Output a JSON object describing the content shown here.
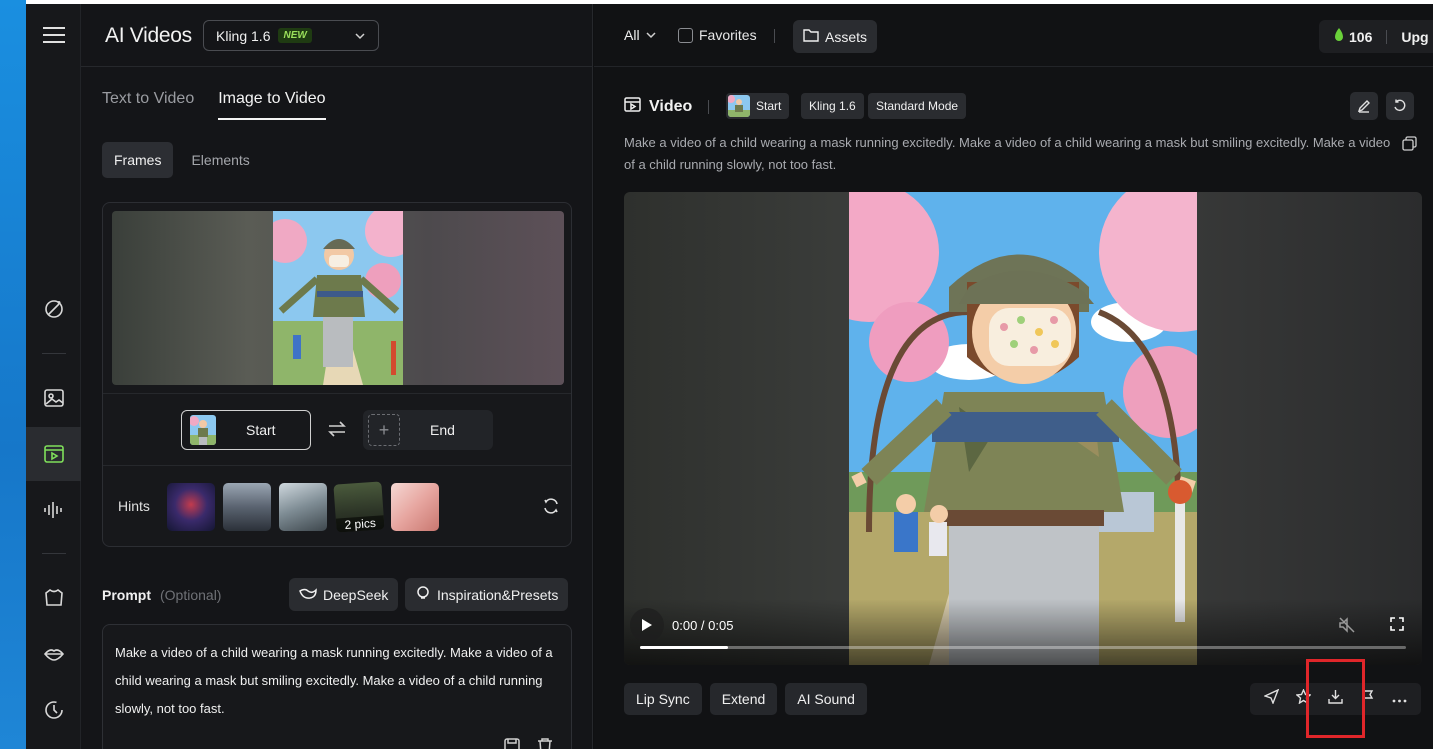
{
  "app": {
    "title": "AI Videos",
    "model": "Kling 1.6",
    "model_badge": "NEW"
  },
  "rail": {
    "items": [
      {
        "icon": "magic-wand-icon"
      },
      {
        "icon": "image-icon"
      },
      {
        "icon": "video-icon",
        "active": true
      },
      {
        "icon": "audio-wave-icon"
      },
      {
        "icon": "shirt-icon"
      },
      {
        "icon": "lips-icon"
      },
      {
        "icon": "history-icon"
      }
    ]
  },
  "creation": {
    "tabs": [
      "Text to Video",
      "Image to Video"
    ],
    "active_tab": "Image to Video",
    "subtabs": [
      "Frames",
      "Elements"
    ],
    "active_subtab": "Frames",
    "start_label": "Start",
    "end_label": "End",
    "hints_label": "Hints",
    "hint_pics_label": "2 pics",
    "prompt_label": "Prompt",
    "prompt_optional": "(Optional)",
    "deepseek_label": "DeepSeek",
    "inspiration_label": "Inspiration&Presets",
    "prompt_text": "Make a video of a child wearing a mask running excitedly. Make a video of a child wearing a mask but smiling excitedly. Make a video of a child running slowly, not too fast."
  },
  "topbar": {
    "filter_label": "All",
    "favorites_label": "Favorites",
    "assets_label": "Assets",
    "credits": "106",
    "upgrade_label": "Upg"
  },
  "video": {
    "title": "Video",
    "chip_start": "Start",
    "chip_model": "Kling 1.6",
    "chip_mode": "Standard Mode",
    "description": "Make a video of a child wearing a mask running excitedly. Make a video of a child wearing a mask but smiling excitedly. Make a video of a child running slowly, not too fast.",
    "time": "0:00 / 0:05",
    "progress": 0.115,
    "actions": [
      "Lip Sync",
      "Extend",
      "AI Sound"
    ]
  },
  "colors": {
    "accent_green": "#9be05b",
    "highlight_red": "#e0262a"
  }
}
